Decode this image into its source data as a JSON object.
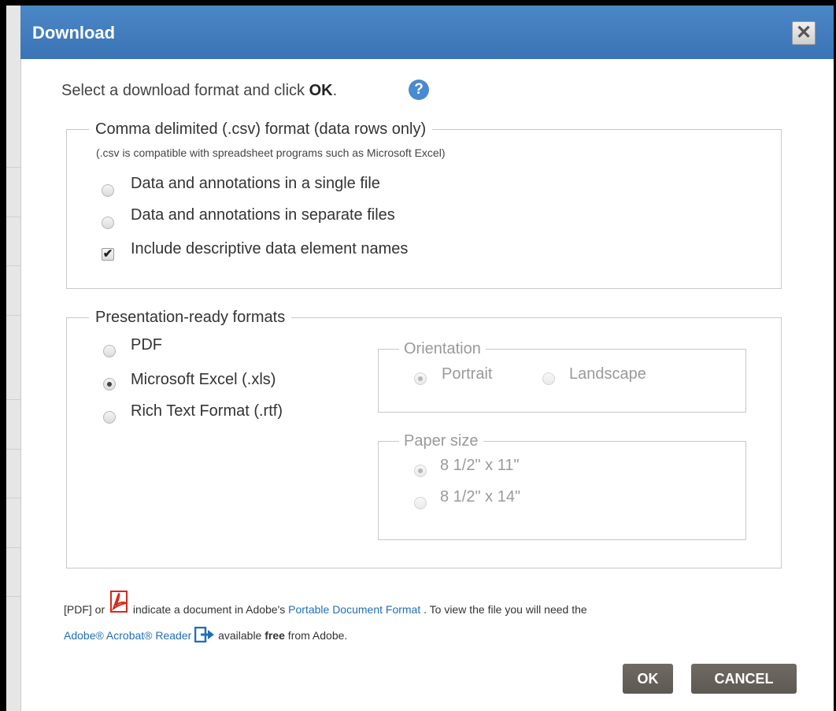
{
  "dialog": {
    "title": "Download",
    "close_symbol": "✕",
    "intro_text": "Select a download format and click ",
    "intro_bold": "OK",
    "intro_end": ".",
    "help_symbol": "?"
  },
  "csv_section": {
    "legend": "Comma delimited (.csv) format (data rows only)",
    "note": "(.csv is compatible with spreadsheet programs such as Microsoft Excel)",
    "options": [
      {
        "label": "Data and annotations in a single file",
        "selected": false
      },
      {
        "label": "Data and annotations in separate files",
        "selected": false
      }
    ],
    "checkbox": {
      "label": "Include descriptive data element names",
      "checked": true
    }
  },
  "presentation_section": {
    "legend": "Presentation-ready formats",
    "formats": [
      {
        "label": "PDF",
        "selected": false
      },
      {
        "label": "Microsoft Excel (.xls)",
        "selected": true
      },
      {
        "label": "Rich Text Format (.rtf)",
        "selected": false
      }
    ],
    "orientation": {
      "legend": "Orientation",
      "options": [
        {
          "label": "Portrait",
          "selected": true
        },
        {
          "label": "Landscape",
          "selected": false
        }
      ]
    },
    "paper_size": {
      "legend": "Paper size",
      "options": [
        {
          "label": "8 1/2\" x 11\"",
          "selected": true
        },
        {
          "label": "8 1/2\" x 14\"",
          "selected": false
        }
      ]
    }
  },
  "footer": {
    "part1": "[PDF] or ",
    "part2": " indicate a document in Adobe's ",
    "link_pdf": "Portable Document Format",
    "part3": " . To view the file you will need the ",
    "link_reader": "Adobe® Acrobat® Reader",
    "part4": " available ",
    "free": "free",
    "part5": " from Adobe."
  },
  "buttons": {
    "ok": "OK",
    "cancel": "CANCEL"
  },
  "icons": {
    "close": "close-icon",
    "help": "help-icon",
    "pdf": "pdf-icon",
    "external": "external-link-icon"
  },
  "colors": {
    "titlebar": "#3f7bbd",
    "button": "#655f59",
    "link": "#1f6fb8"
  }
}
